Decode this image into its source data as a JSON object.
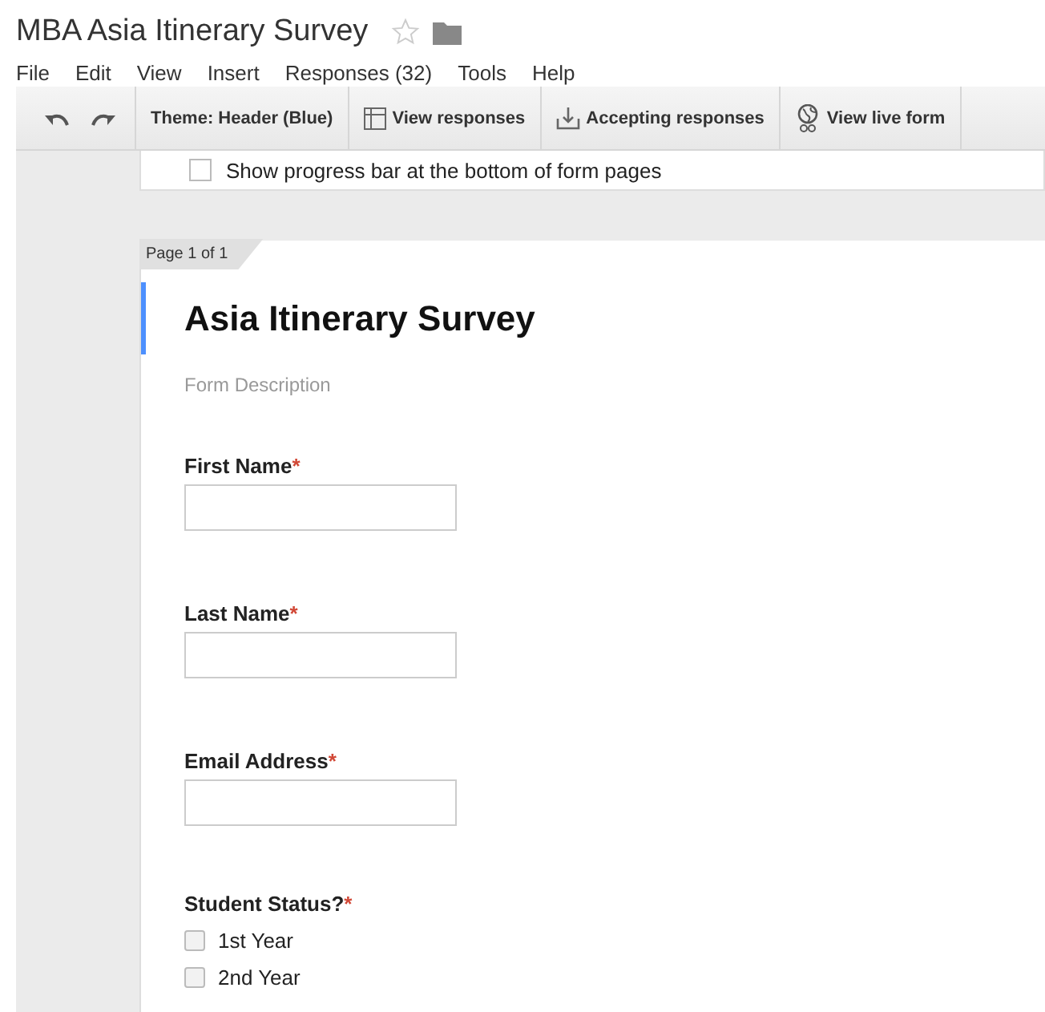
{
  "document": {
    "title": "MBA Asia Itinerary Survey",
    "starred": false
  },
  "menu": [
    "File",
    "Edit",
    "View",
    "Insert",
    "Responses (32)",
    "Tools",
    "Help"
  ],
  "toolbar": [
    {
      "kind": "undo"
    },
    {
      "kind": "redo"
    },
    {
      "kind": "text",
      "label": "Theme: Header (Blue)"
    },
    {
      "kind": "table",
      "label": "View responses"
    },
    {
      "kind": "download",
      "label": "Accepting responses"
    },
    {
      "kind": "globe",
      "label": "View live form"
    }
  ],
  "settings": {
    "label": "Show progress bar at the bottom of form pages",
    "checked": false
  },
  "page": {
    "tab": "Page 1 of 1",
    "title": "Asia Itinerary Survey",
    "description": "Form Description",
    "questions": [
      {
        "kind": "text",
        "label": "First Name",
        "required_mark": "*"
      },
      {
        "kind": "text",
        "label": "Last Name",
        "required_mark": "*"
      },
      {
        "kind": "text",
        "label": "Email Address",
        "required_mark": "*"
      },
      {
        "kind": "checkboxes",
        "label": "Student Status?",
        "required_mark": "*",
        "options": [
          {
            "label": "1st Year",
            "checked": false
          },
          {
            "label": "2nd Year",
            "checked": false
          }
        ]
      }
    ]
  }
}
